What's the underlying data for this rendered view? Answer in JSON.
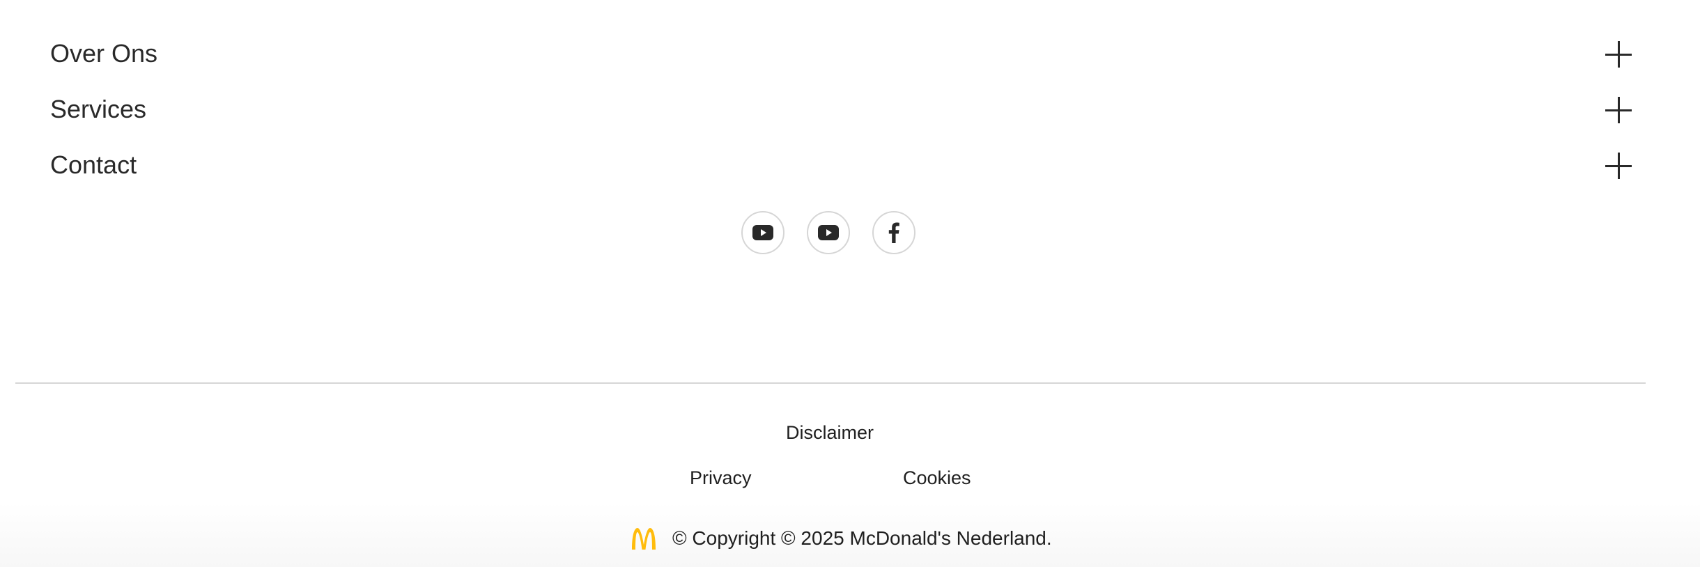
{
  "accordion": {
    "items": [
      {
        "label": "Over Ons"
      },
      {
        "label": "Services"
      },
      {
        "label": "Contact"
      }
    ]
  },
  "socials": [
    {
      "icon": "youtube-icon"
    },
    {
      "icon": "youtube-icon"
    },
    {
      "icon": "facebook-icon"
    }
  ],
  "legal": {
    "disclaimer": "Disclaimer",
    "privacy": "Privacy",
    "cookies": "Cookies"
  },
  "copyright": {
    "text": "© Copyright © 2025 McDonald's Nederland.",
    "logo_color": "#FFBC0D"
  }
}
